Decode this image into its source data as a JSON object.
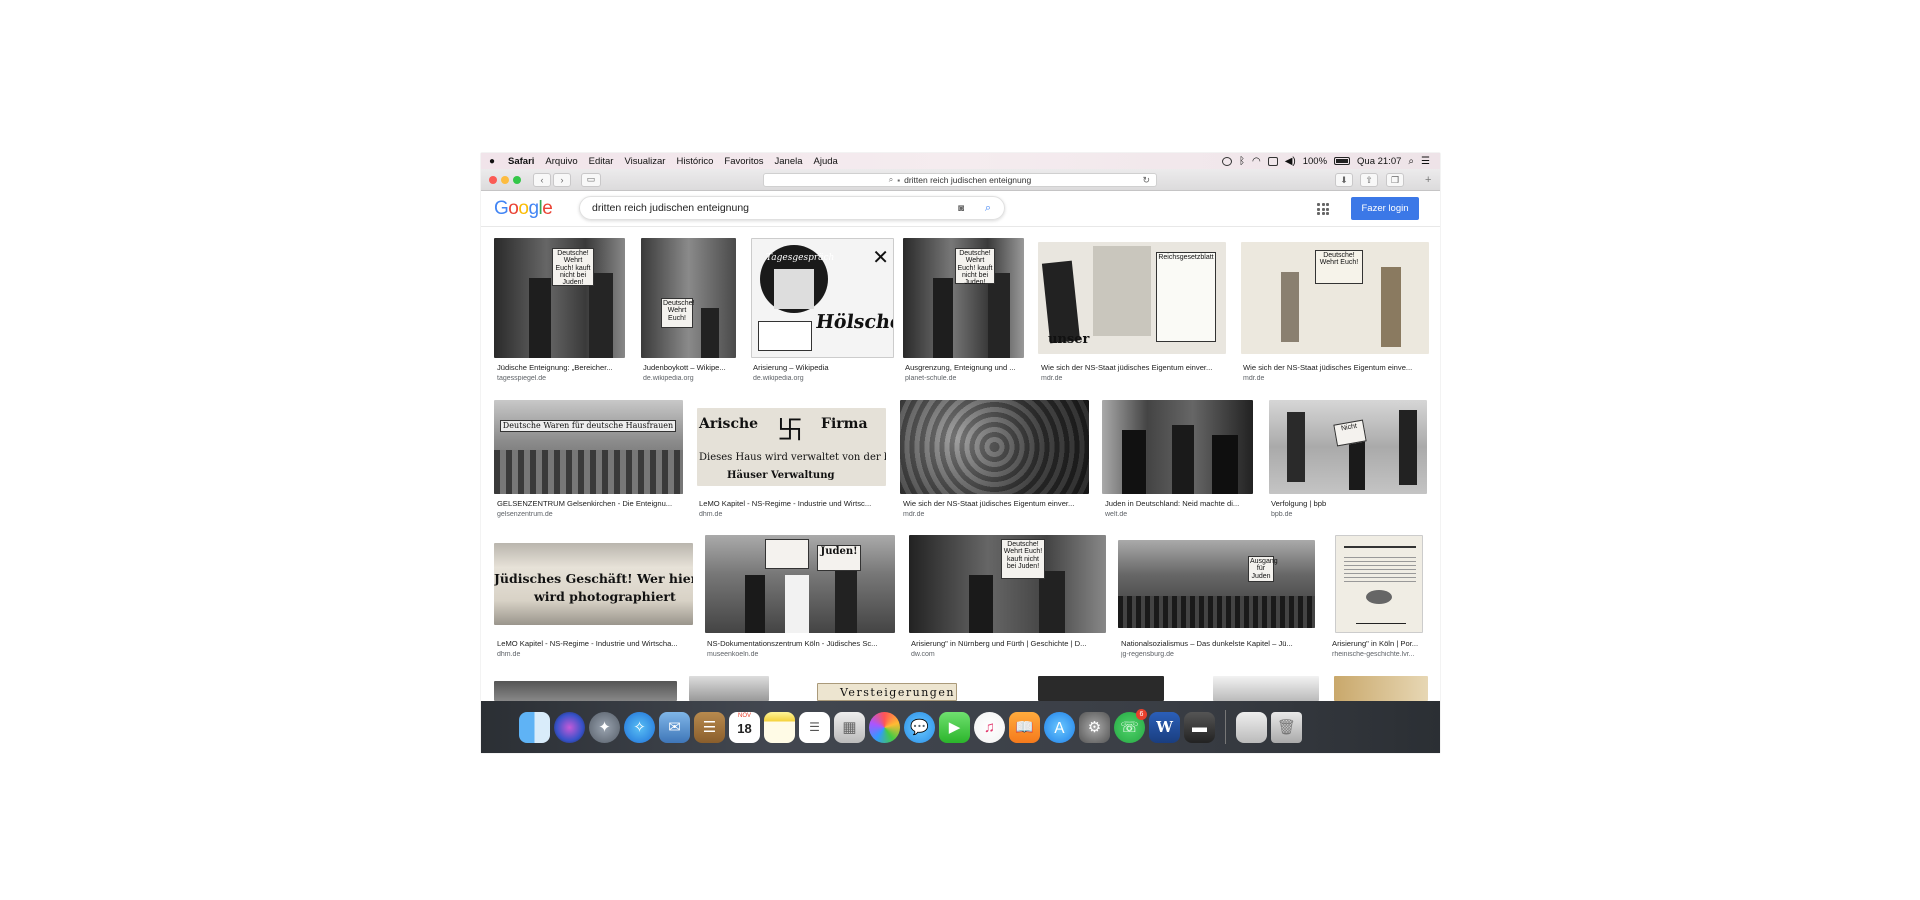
{
  "menubar": {
    "app_name": "Safari",
    "items": [
      "Arquivo",
      "Editar",
      "Visualizar",
      "Histórico",
      "Favoritos",
      "Janela",
      "Ajuda"
    ],
    "battery": "100%",
    "clock": "Qua 21:07"
  },
  "browser": {
    "address": "dritten reich judischen enteignung"
  },
  "google": {
    "logo": "Google",
    "query": "dritten reich judischen enteignung",
    "login_label": "Fazer login"
  },
  "results": [
    {
      "title": "Jüdische Enteignung: „Bereicher...",
      "domain": "tagesspiegel.de"
    },
    {
      "title": "Judenboykott – Wikipe...",
      "domain": "de.wikipedia.org"
    },
    {
      "title": "Arisierung – Wikipedia",
      "domain": "de.wikipedia.org"
    },
    {
      "title": "Ausgrenzung, Enteignung und ...",
      "domain": "planet-schule.de"
    },
    {
      "title": "Wie sich der NS-Staat jüdisches Eigentum einver...",
      "domain": "mdr.de"
    },
    {
      "title": "Wie sich der NS-Staat jüdisches Eigentum einve...",
      "domain": "mdr.de"
    },
    {
      "title": "GELSENZENTRUM Gelsenkirchen - Die Enteignu...",
      "domain": "gelsenzentrum.de"
    },
    {
      "title": "LeMO Kapitel - NS-Regime - Industrie und Wirtsc...",
      "domain": "dhm.de"
    },
    {
      "title": "Wie sich der NS-Staat jüdisches Eigentum einver...",
      "domain": "mdr.de"
    },
    {
      "title": "Juden in Deutschland: Neid machte di...",
      "domain": "welt.de"
    },
    {
      "title": "Verfolgung | bpb",
      "domain": "bpb.de"
    },
    {
      "title": "LeMO Kapitel - NS-Regime - Industrie und Wirtscha...",
      "domain": "dhm.de"
    },
    {
      "title": "NS-Dokumentationszentrum Köln - Jüdisches Sc...",
      "domain": "museenkoeln.de"
    },
    {
      "title": "Arisierung\" in Nürnberg und Fürth | Geschichte | D...",
      "domain": "dw.com"
    },
    {
      "title": "Nationalsozialismus – Das dunkelste Kapitel – Jü...",
      "domain": "jg-regensburg.de"
    },
    {
      "title": "Arisierung\" in Köln | Por...",
      "domain": "rheinische-geschichte.lvr..."
    }
  ],
  "thumb_text": {
    "t1_sign": "Deutsche! Wehrt Euch! kauft nicht bei Juden!",
    "t2_sign": "Deutsche! Wehrt Euch!",
    "t3_head": "Tagesgespräch",
    "t3_name": "Hölscher",
    "t5_head": "Reichsgesetzblatt",
    "t5_word": "unser",
    "t7_banner": "Deutsche Waren für deutsche Hausfrauen",
    "t8_left": "Arische",
    "t8_right": "Firma",
    "t8_line": "Dieses Haus wird verwaltet von der beh. konzess.",
    "t8_line2": "Häuser Verwaltung",
    "t11_sign": "Nicht",
    "t12_line1": "Jüdisches Geschäft! Wer hier kauft",
    "t12_line2": "wird photographiert",
    "t13_sign": "Juden!",
    "t15_sign": "Ausgang für Juden",
    "t17_sign": "Versteigerungen"
  },
  "dock": {
    "calendar_day": "18",
    "calendar_month": "NOV",
    "whatsapp_badge": "6",
    "word_label": "W"
  },
  "colors": {
    "accent": "#3b78e7",
    "google_blue": "#4285f4",
    "google_red": "#ea4335",
    "google_yellow": "#fbbc05",
    "google_green": "#34a853"
  }
}
